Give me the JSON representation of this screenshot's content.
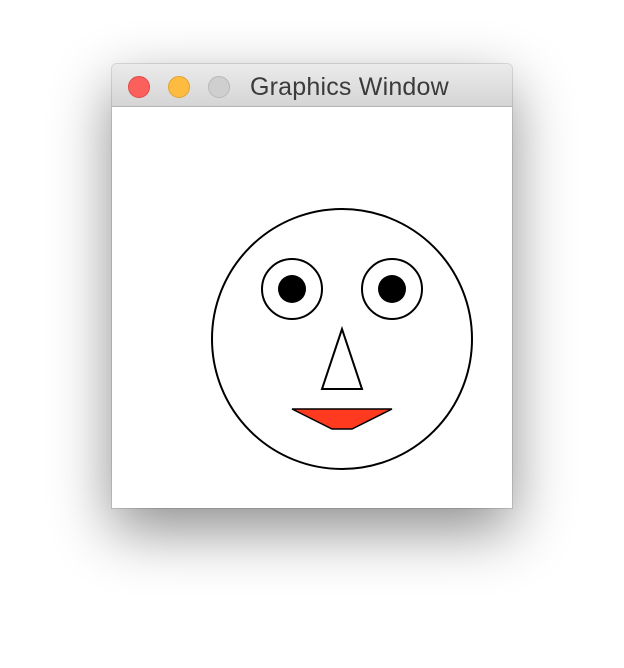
{
  "window": {
    "title": "Graphics Window",
    "controls": {
      "close": "close-icon",
      "minimize": "minimize-icon",
      "zoom": "zoom-icon"
    }
  },
  "colors": {
    "close": "#fc605c",
    "minimize": "#fdbc40",
    "zoom": "#cfcfcf",
    "mouth_fill": "#ff3a1e",
    "outline": "#000000",
    "pupil": "#000000",
    "canvas_background": "#ffffff"
  }
}
